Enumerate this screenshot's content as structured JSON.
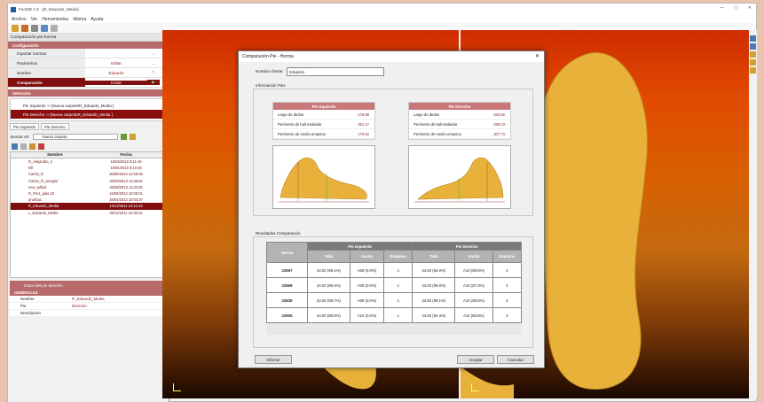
{
  "window": {
    "title": "Foot3D 1.6 - [R_Eduardo_Media]"
  },
  "menu": [
    "Archivo",
    "Ver",
    "Herramientas",
    "Idioma",
    "Ayuda"
  ],
  "left_panel": {
    "title": "Comparación pie-horma",
    "configuracion_label": "Configuración",
    "config_rows": [
      {
        "label": "Importar hormas",
        "value": "",
        "action": "..."
      },
      {
        "label": "Parámetros",
        "value": "Editar",
        "action": "..."
      },
      {
        "label": "Nombre",
        "value": "Eduardo",
        "action": ""
      },
      {
        "label": "Comparación",
        "value": "Iniciar",
        "action": ""
      }
    ],
    "seleccion_label": "Selección",
    "selection_items": [
      "Pie Izquierdo -> [Nueva carpeta\\R_Eduardo_Media ]",
      "Pie Derecho -> [Nueva carpeta\\R_Eduardo_Media ]"
    ],
    "foot_tabs": [
      "Pie Izquierdo",
      "Pie Derecho"
    ],
    "search_label": "Buscar en:",
    "search_value": "Nueva carpeta",
    "file_headers": {
      "name": "Nombre",
      "date": "Fecha"
    },
    "files": [
      {
        "name": "R_Alejandro_1",
        "date": "10/04/2015 8:11:49"
      },
      {
        "name": "left",
        "date": "10/04/2015 8:10:46"
      },
      {
        "name": "Carlos_R",
        "date": "30/09/2013 12:59:06"
      },
      {
        "name": "Carlos_R_arreglar",
        "date": "30/09/2013 11:39:04"
      },
      {
        "name": "new_adfad",
        "date": "30/09/2013 11:33:32"
      },
      {
        "name": "R_Pie1_pala 22",
        "date": "16/09/2013 10:09:01"
      },
      {
        "name": "prueba1",
        "date": "26/04/2013 10:53:07"
      },
      {
        "name": "R_Eduardo_Media",
        "date": "14/12/2011 10:12:43"
      },
      {
        "name": "L_Eduardo_Media",
        "date": "30/11/2011 16:38:43"
      }
    ],
    "datos_label": "Datos del pie derecho",
    "generales_label": "GENERALES",
    "props": [
      {
        "key": "Nombre",
        "value": "R_Eduardo_Media"
      },
      {
        "key": "Pie",
        "value": "Derecho"
      },
      {
        "key": "Descripción",
        "value": ""
      }
    ]
  },
  "dialog": {
    "title": "Comparación Pie - Horma",
    "client_label": "Nombre cliente:",
    "client_value": "Eduardo",
    "info_label": "Información Pies",
    "left_card": {
      "title": "Pie Izquierdo",
      "rows": [
        {
          "k": "Largo de dedos",
          "v": "278.98"
        },
        {
          "k": "Perímetro de ball estándar",
          "v": "251.17"
        },
        {
          "k": "Perímetro de medio empeine",
          "v": "175.52"
        }
      ]
    },
    "right_card": {
      "title": "Pie Derecho",
      "rows": [
        {
          "k": "Largo de dedos",
          "v": "283.92"
        },
        {
          "k": "Perímetro de ball estándar",
          "v": "258.23"
        },
        {
          "k": "Perímetro de medio empeine",
          "v": "307.73"
        }
      ]
    },
    "results_label": "Resultados Comparación",
    "table": {
      "group_left": "Pie Izquierdo",
      "group_right": "Pie Derecho",
      "col_horma": "Horma",
      "cols": [
        "Talla",
        "Ancho",
        "Empeine"
      ],
      "rows": [
        {
          "horma": "22667",
          "l": [
            "43.00 (99.1%)",
            "A09 (0.0%)",
            "1"
          ],
          "r": [
            "44.00 (94.0%)",
            "A10 (88.8%)",
            "3"
          ]
        },
        {
          "horma": "22668",
          "l": [
            "43.00 (98.4%)",
            "A09 (0.0%)",
            "1"
          ],
          "r": [
            "44.00 (99.0%)",
            "A10 (87.0%)",
            "3"
          ]
        },
        {
          "horma": "22839",
          "l": [
            "43.00 (98.7%)",
            "A09 (0.0%)",
            "1"
          ],
          "r": [
            "43.50 (98.1%)",
            "A10 (89.6%)",
            "3"
          ]
        },
        {
          "horma": "22905",
          "l": [
            "43.00 (99.5%)",
            "A10 (0.0%)",
            "1"
          ],
          "r": [
            "44.00 (94.4%)",
            "A11 (88.6%)",
            "3"
          ]
        }
      ]
    },
    "btn_informe": "Informe",
    "btn_aceptar": "Aceptar",
    "btn_cancelar": "Cancelar"
  },
  "colors": {
    "accent": "#7f0f0f",
    "section": "#b86a6a",
    "viewport_top": "#cf2d00",
    "foot": "#e8b23a"
  }
}
